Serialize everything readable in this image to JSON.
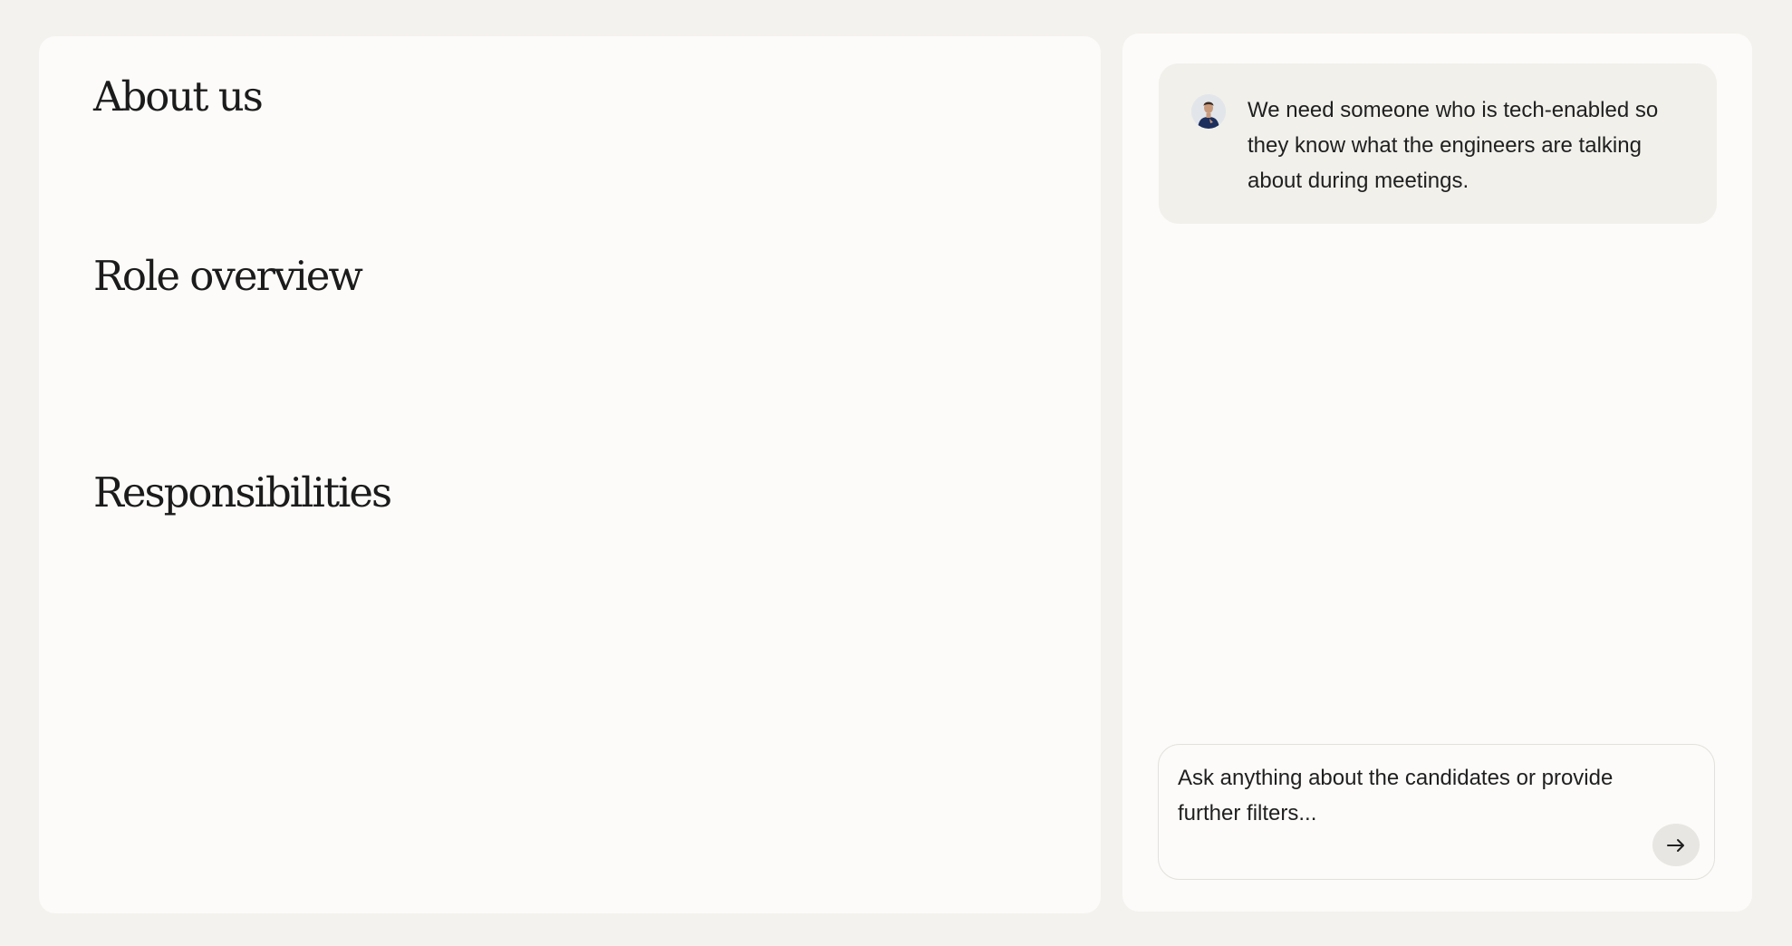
{
  "left_panel": {
    "sections": [
      {
        "heading": "About us"
      },
      {
        "heading": "Role overview"
      },
      {
        "heading": "Responsibilities"
      }
    ]
  },
  "chat": {
    "message": {
      "avatar_icon": "person-avatar-icon",
      "text": "We need someone who is tech-enabled so they know what the engineers are talking about during meetings."
    },
    "input": {
      "placeholder": "Ask anything about the candidates or provide further filters...",
      "value": ""
    },
    "send_button": {
      "icon": "arrow-right-icon"
    }
  },
  "colors": {
    "page_background": "#f4f2ee",
    "panel_background": "#fcfbf9",
    "bubble_background": "#f1f0eb",
    "text": "#1f1f1f",
    "send_button_background": "#e7e6e2"
  }
}
